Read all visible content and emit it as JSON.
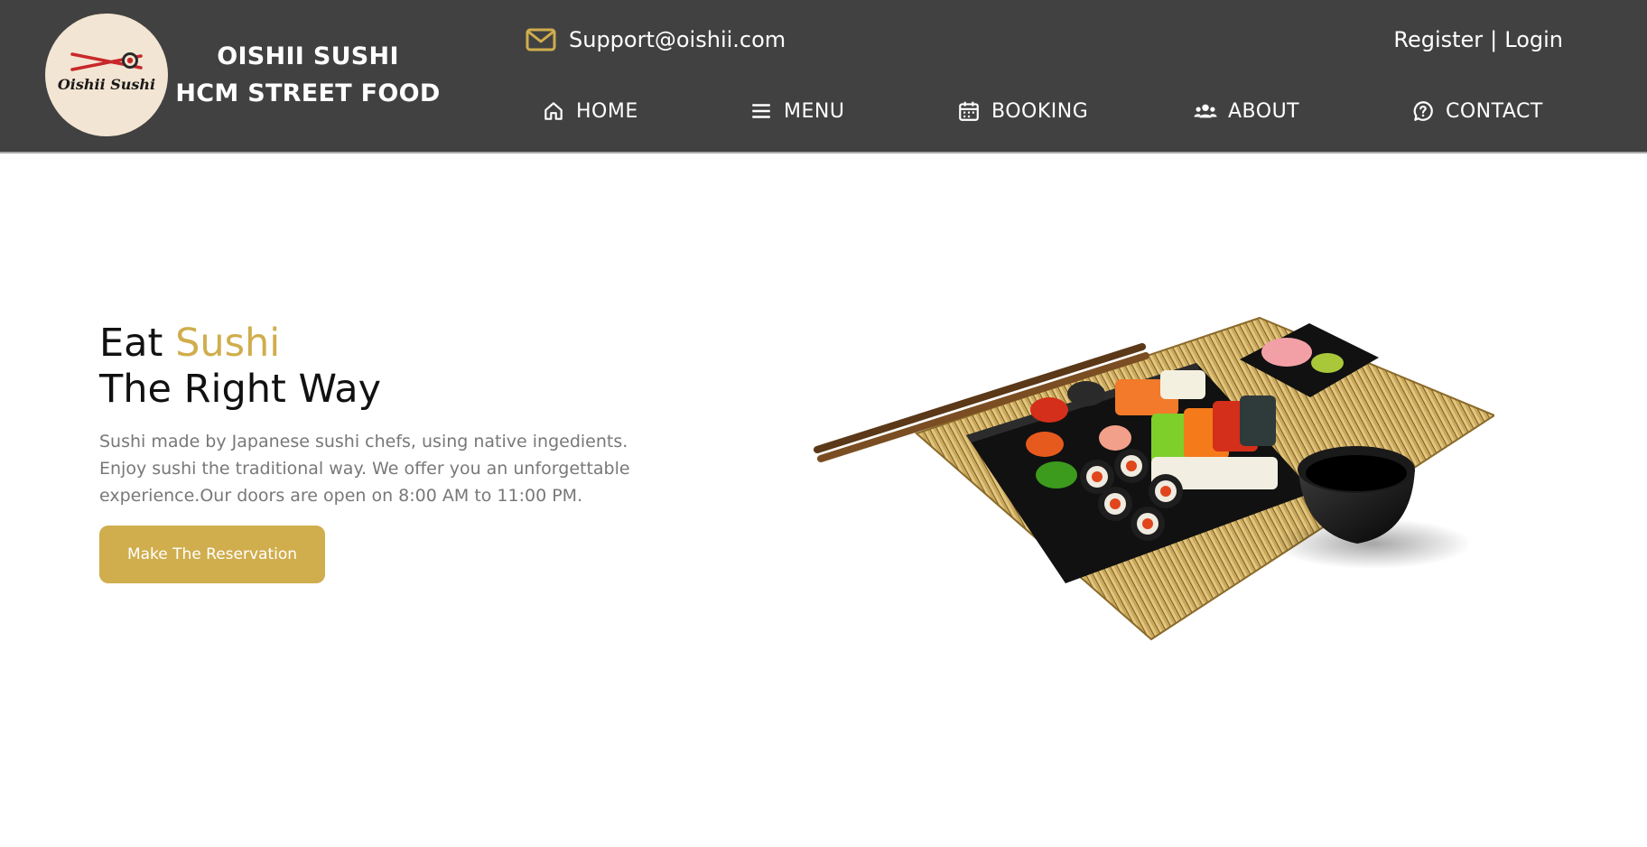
{
  "brand": {
    "logo_text": "Oishii Sushi",
    "line1": "OISHII SUSHI",
    "line2": "HCM STREET FOOD"
  },
  "contact": {
    "email": "Support@oishii.com",
    "icon": "mail-icon"
  },
  "auth": {
    "register": "Register",
    "separator": "|",
    "login": "Login"
  },
  "nav": {
    "home": {
      "label": "HOME",
      "icon": "home-icon"
    },
    "menu": {
      "label": "MENU",
      "icon": "hamburger-menu-icon"
    },
    "booking": {
      "label": "BOOKING",
      "icon": "calendar-icon"
    },
    "about": {
      "label": "ABOUT",
      "icon": "people-icon"
    },
    "contact": {
      "label": "CONTACT",
      "icon": "help-circle-icon"
    }
  },
  "hero": {
    "title_part1": "Eat ",
    "title_accent": "Sushi",
    "title_line2": "The Right Way",
    "description": "Sushi made by Japanese sushi chefs, using native ingedients. Enjoy sushi the traditional way. We offer you an unforgettable experience.Our doors are open on 8:00 AM to 11:00 PM.",
    "cta_label": "Make The Reservation",
    "image": "sushi-platter-image"
  },
  "colors": {
    "header_bg": "#414141",
    "accent": "#d0ad4d",
    "logo_bg": "#f3e5d3"
  }
}
